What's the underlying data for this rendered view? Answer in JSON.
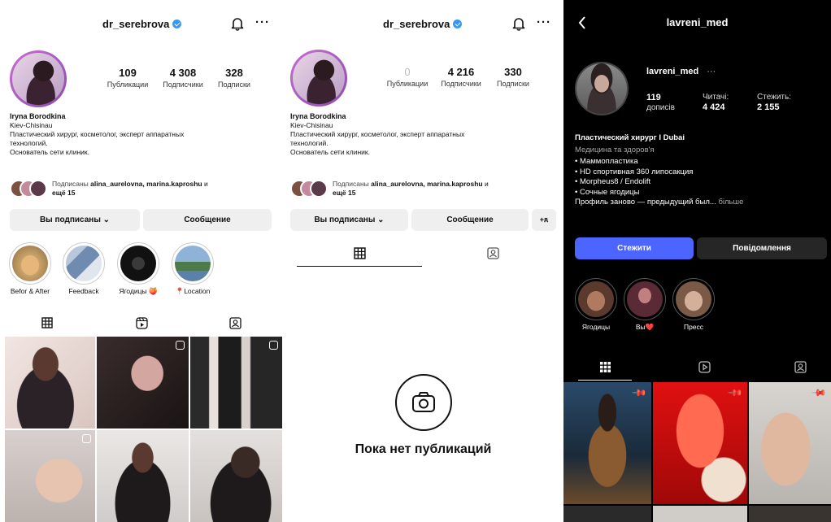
{
  "panel1": {
    "username": "dr_serebrova",
    "stats": [
      {
        "value": "109",
        "label": "Публикации"
      },
      {
        "value": "4 308",
        "label": "Подписчики"
      },
      {
        "value": "328",
        "label": "Подписки"
      }
    ],
    "bio": {
      "name": "Iryna Borodkina",
      "location": "Kiev-Chisinau",
      "line1": "Пластический хирург, косметолог, эксперт аппаратных",
      "line2": "технологий.",
      "line3": "Основатель сети клиник."
    },
    "followed_by": {
      "prefix": "Подписаны",
      "names": "alina_aurelovna, marina.kaproshu",
      "suffix": "и",
      "more": "ещё 15"
    },
    "buttons": {
      "following": "Вы подписаны ⌄",
      "message": "Сообщение"
    },
    "highlights": [
      {
        "label": "Befor & After",
        "color": "#c9a36a"
      },
      {
        "label": "Feedback",
        "color": "#6f8bb0"
      },
      {
        "label": "Ягодицы 🍑",
        "color": "#1a1a1a"
      },
      {
        "label": "📍Location",
        "color": "#5a82a8"
      }
    ]
  },
  "panel2": {
    "username": "dr_serebrova",
    "stats": [
      {
        "value": "0",
        "label": "Публикации"
      },
      {
        "value": "4 216",
        "label": "Подписчики"
      },
      {
        "value": "330",
        "label": "Подписки"
      }
    ],
    "bio": {
      "name": "Iryna Borodkina",
      "location": "Kiev-Chisinau",
      "line1": "Пластический хирург, косметолог, эксперт аппаратных",
      "line2": "технологий.",
      "line3": "Основатель сети клиник."
    },
    "followed_by": {
      "prefix": "Подписаны",
      "names": "alina_aurelovna, marina.kaproshu",
      "suffix": "и",
      "more": "ещё 15"
    },
    "buttons": {
      "following": "Вы подписаны ⌄",
      "message": "Сообщение",
      "add": "+ጸ"
    },
    "empty_text": "Пока нет публикаций"
  },
  "panel3": {
    "title": "lavreni_med",
    "username": "lavreni_med",
    "more": "···",
    "stats": [
      {
        "value": "119",
        "label": "дописів"
      },
      {
        "value": "4 424",
        "label": "Читачі:"
      },
      {
        "value": "2 155",
        "label": "Стежить:"
      }
    ],
    "bio": {
      "name": "Пластический хирург I Dubai",
      "category": "Медицина та здоров'я",
      "line1": "• Маммопластика",
      "line2": "• HD спортивная 360 липосакция",
      "line3": "• Morpheus8 / Endolift",
      "line4": "• Сочные ягодицы",
      "line5": "Профиль заново — предыдущий был...",
      "line5_more": "більше"
    },
    "buttons": {
      "follow": "Стежити",
      "message": "Повідомлення"
    },
    "highlights": [
      {
        "label": "Ягодицы",
        "color": "#8a5a44"
      },
      {
        "label": "Вы❤️",
        "color": "#7a3f4a"
      },
      {
        "label": "Пресс",
        "color": "#a07a5f"
      }
    ]
  },
  "colors": {
    "accent_blue": "#4c65ff",
    "verified_blue": "#3897f0"
  }
}
